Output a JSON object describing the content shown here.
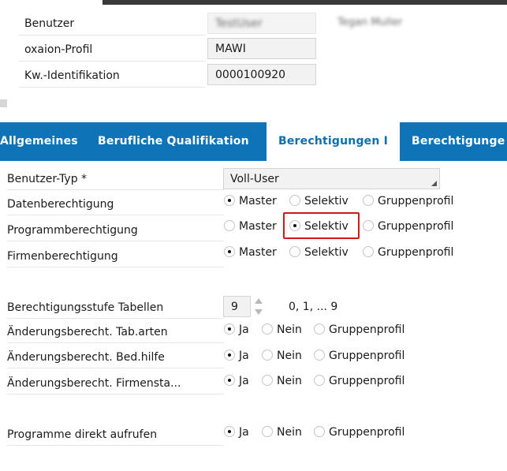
{
  "header": {
    "fields": [
      {
        "label": "Benutzer",
        "value": "TestUser",
        "extra": "Tegan Muller",
        "blurred": true
      },
      {
        "label": "oxaion-Profil",
        "value": "MAWI"
      },
      {
        "label": "Kw.-Identifikation",
        "value": "0000100920"
      }
    ]
  },
  "tabs": [
    {
      "label": "Allgemeines",
      "active": false
    },
    {
      "label": "Berufliche Qualifikation",
      "active": false
    },
    {
      "label": "Berechtigungen I",
      "active": true
    },
    {
      "label": "Berechtigunge",
      "active": false
    }
  ],
  "form": {
    "benutzer_typ": {
      "label": "Benutzer-Typ *",
      "value": "Voll-User"
    },
    "daten": {
      "label": "Datenberechtigung",
      "options": [
        "Master",
        "Selektiv",
        "Gruppenprofil"
      ],
      "selected": "Master"
    },
    "programm": {
      "label": "Programmberechtigung",
      "options": [
        "Master",
        "Selektiv",
        "Gruppenprofil"
      ],
      "selected": "Selektiv"
    },
    "firmen": {
      "label": "Firmenberechtigung",
      "options": [
        "Master",
        "Selektiv",
        "Gruppenprofil"
      ],
      "selected": "Master"
    },
    "stufe": {
      "label": "Berechtigungsstufe Tabellen",
      "value": "9",
      "hint": "0, 1, ... 9"
    },
    "tabarten": {
      "label": "Änderungsberecht. Tab.arten",
      "options": [
        "Ja",
        "Nein",
        "Gruppenprofil"
      ],
      "selected": "Ja"
    },
    "bedhilfe": {
      "label": "Änderungsberecht. Bed.hilfe",
      "options": [
        "Ja",
        "Nein",
        "Gruppenprofil"
      ],
      "selected": "Ja"
    },
    "firmensta": {
      "label": "Änderungsberecht. Firmensta...",
      "options": [
        "Ja",
        "Nein",
        "Gruppenprofil"
      ],
      "selected": "Ja"
    },
    "direkt": {
      "label": "Programme direkt aufrufen",
      "options": [
        "Ja",
        "Nein",
        "Gruppenprofil"
      ],
      "selected": "Ja"
    }
  },
  "colors": {
    "tabbar": "#0f73b8",
    "active_tab_text": "#0f6fae",
    "highlight": "#d01818"
  }
}
